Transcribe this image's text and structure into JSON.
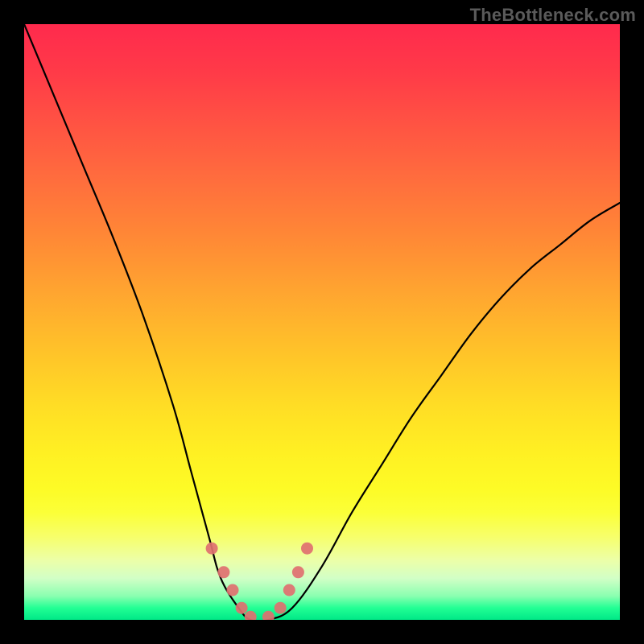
{
  "watermark": "TheBottleneck.com",
  "colors": {
    "background": "#000000",
    "curve_stroke": "#000000",
    "marker_fill": "#e07070",
    "gradient_top": "#ff2a4d",
    "gradient_bottom": "#00e887"
  },
  "chart_data": {
    "type": "line",
    "title": "",
    "xlabel": "",
    "ylabel": "",
    "xlim": [
      0,
      100
    ],
    "ylim": [
      0,
      100
    ],
    "grid": false,
    "legend": false,
    "note": "V-shaped bottleneck curve over rainbow heat gradient; y is a bottleneck/mismatch percentage (0 = ideal match, bottom; 100 = severe, top). x is a relative performance index. No numeric axis labels are shown in the image; values below are read off the curve shape proportionally.",
    "series": [
      {
        "name": "bottleneck-curve",
        "x": [
          0,
          5,
          10,
          15,
          20,
          25,
          28,
          31,
          33,
          36,
          38,
          41,
          45,
          50,
          55,
          60,
          65,
          70,
          75,
          80,
          85,
          90,
          95,
          100
        ],
        "y": [
          100,
          88,
          76,
          64,
          51,
          36,
          25,
          14,
          7,
          2,
          0,
          0,
          2,
          9,
          18,
          26,
          34,
          41,
          48,
          54,
          59,
          63,
          67,
          70
        ]
      }
    ],
    "markers": {
      "name": "near-minimum-markers",
      "x": [
        31.5,
        33.5,
        35,
        36.5,
        38,
        41,
        43,
        44.5,
        46,
        47.5
      ],
      "y": [
        12,
        8,
        5,
        2,
        0.5,
        0.5,
        2,
        5,
        8,
        12
      ]
    }
  }
}
